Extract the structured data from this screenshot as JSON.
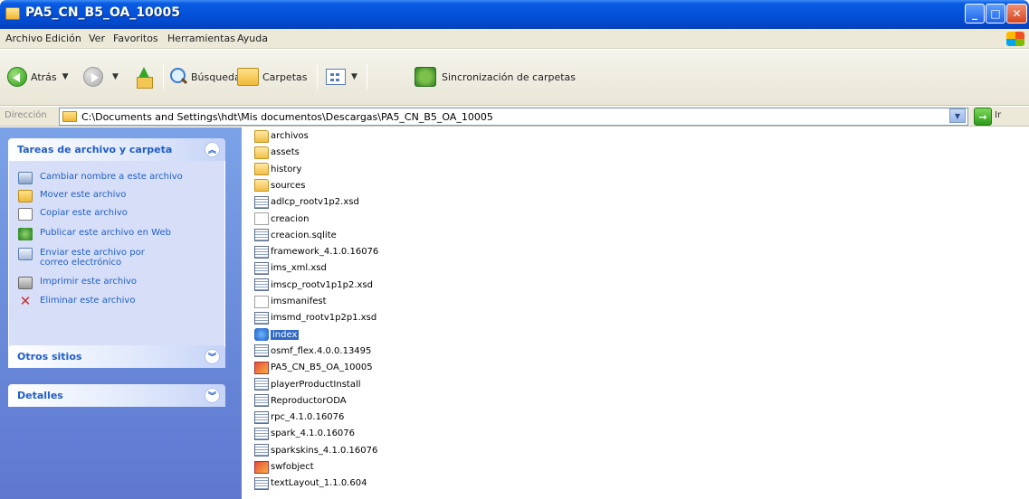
{
  "window": {
    "title": "PA5_CN_B5_OA_10005"
  },
  "menu": [
    "Archivo",
    "Edición",
    "Ver",
    "Favoritos",
    "Herramientas",
    "Ayuda"
  ],
  "toolbar": {
    "back_label": "Atrás",
    "search_label": "Búsqueda",
    "folders_label": "Carpetas",
    "sync_label": "Sincronización de carpetas"
  },
  "address": {
    "label": "Dirección",
    "path": "C:\\Documents and Settings\\hdt\\Mis documentos\\Descargas\\PA5_CN_B5_OA_10005",
    "go_label": "Ir"
  },
  "sidebar": {
    "tasks_panel": {
      "title": "Tareas de archivo y carpeta",
      "items": [
        {
          "label": "Cambiar nombre a este archivo",
          "icon": "rename-icon"
        },
        {
          "label": "Mover este archivo",
          "icon": "move-icon"
        },
        {
          "label": "Copiar este archivo",
          "icon": "copy-icon"
        },
        {
          "label": "Publicar este archivo en Web",
          "icon": "web-publish-icon"
        },
        {
          "label": "Enviar este archivo por correo electrónico",
          "icon": "email-icon"
        },
        {
          "label": "Imprimir este archivo",
          "icon": "print-icon"
        },
        {
          "label": "Eliminar este archivo",
          "icon": "delete-icon"
        }
      ]
    },
    "other_places_panel": {
      "title": "Otros sitios"
    },
    "details_panel": {
      "title": "Detalles"
    }
  },
  "files": [
    {
      "name": "archivos",
      "type": "folder"
    },
    {
      "name": "assets",
      "type": "folder"
    },
    {
      "name": "history",
      "type": "folder"
    },
    {
      "name": "sources",
      "type": "folder"
    },
    {
      "name": "adlcp_rootv1p2.xsd",
      "type": "doc"
    },
    {
      "name": "creacion",
      "type": "plain"
    },
    {
      "name": "creacion.sqlite",
      "type": "doc"
    },
    {
      "name": "framework_4.1.0.16076",
      "type": "doc"
    },
    {
      "name": "ims_xml.xsd",
      "type": "doc"
    },
    {
      "name": "imscp_rootv1p1p2.xsd",
      "type": "doc"
    },
    {
      "name": "imsmanifest",
      "type": "plain"
    },
    {
      "name": "imsmd_rootv1p2p1.xsd",
      "type": "doc"
    },
    {
      "name": "index",
      "type": "ie",
      "selected": true
    },
    {
      "name": "osmf_flex.4.0.0.13495",
      "type": "doc"
    },
    {
      "name": "PA5_CN_B5_OA_10005",
      "type": "swf"
    },
    {
      "name": "playerProductInstall",
      "type": "doc"
    },
    {
      "name": "ReproductorODA",
      "type": "doc"
    },
    {
      "name": "rpc_4.1.0.16076",
      "type": "doc"
    },
    {
      "name": "spark_4.1.0.16076",
      "type": "doc"
    },
    {
      "name": "sparkskins_4.1.0.16076",
      "type": "doc"
    },
    {
      "name": "swfobject",
      "type": "swf"
    },
    {
      "name": "textLayout_1.1.0.604",
      "type": "doc"
    }
  ]
}
